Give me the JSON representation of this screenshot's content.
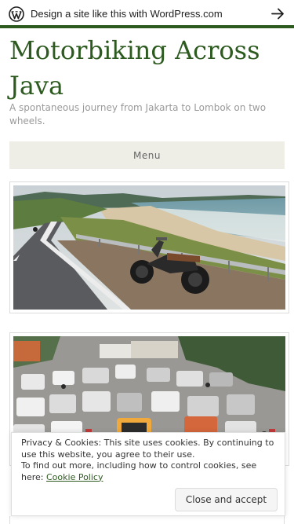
{
  "wp_banner": {
    "text": "Design a site like this with WordPress.com",
    "logo_icon": "wordpress-logo-icon",
    "arrow_icon": "arrow-right-icon"
  },
  "site": {
    "title": "Motorbiking Across Java",
    "tagline": "A spontaneous journey from Jakarta to Lombok on two wheels."
  },
  "nav": {
    "menu_label": "Menu"
  },
  "photos": [
    {
      "description_icon": "coastal-road-motorbike-photo"
    },
    {
      "description_icon": "traffic-jam-photo"
    }
  ],
  "cookie_notice": {
    "line1": "Privacy & Cookies: This site uses cookies. By continuing to use this website, you agree to their use.",
    "line2_prefix": "To find out more, including how to control cookies, see here: ",
    "link_label": "Cookie Policy",
    "accept_label": "Close and accept"
  },
  "colors": {
    "accent": "#2c5a1f",
    "menu_bg": "#efeee6",
    "tagline": "#9a9a9a"
  }
}
